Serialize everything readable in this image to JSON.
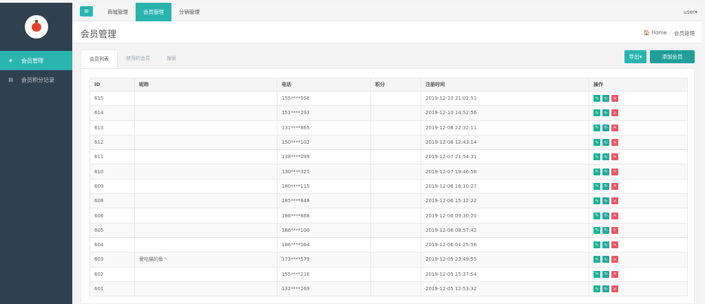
{
  "sidebar": {
    "items": [
      {
        "label": "会员管理",
        "icon": "shield-icon",
        "glyph": "◈",
        "active": true
      },
      {
        "label": "会员积分记录",
        "icon": "list-icon",
        "glyph": "▤",
        "active": false
      }
    ]
  },
  "topbar": {
    "menu_glyph": "≡",
    "nav": [
      {
        "label": "商城管理",
        "active": false
      },
      {
        "label": "会员管理",
        "active": true
      },
      {
        "label": "分销管理",
        "active": false
      }
    ],
    "user": "user▾"
  },
  "header": {
    "title": "会员管理",
    "breadcrumb": {
      "home": "🏠 Home",
      "sep": "/",
      "current": "会员管理"
    }
  },
  "tabs": [
    {
      "label": "会员列表",
      "active": true
    },
    {
      "label": "禁用的会员",
      "active": false
    },
    {
      "label": "搜索",
      "active": false
    }
  ],
  "actions": {
    "export_label": "导出▾",
    "add_label": "添加会员"
  },
  "table": {
    "columns": [
      "ID",
      "昵称",
      "电话",
      "积分",
      "注册时间",
      "操作"
    ],
    "rows": [
      [
        "615",
        "",
        "155****558",
        "",
        "2019-12-10 21:02:51"
      ],
      [
        "614",
        "",
        "151****293",
        "",
        "2019-12-10 14:52:56"
      ],
      [
        "613",
        "",
        "131****865",
        "",
        "2019-12-08 22:32:11"
      ],
      [
        "612",
        "",
        "150****102",
        "",
        "2019-12-08 12:43:14"
      ],
      [
        "611",
        "",
        "138****099",
        "",
        "2019-12-07 21:54:31"
      ],
      [
        "610",
        "",
        "130****321",
        "",
        "2019-12-07 19:46:56"
      ],
      [
        "609",
        "",
        "180****115",
        "",
        "2019-12-06 16:10:27"
      ],
      [
        "608",
        "",
        "185****848",
        "",
        "2019-12-06 15:12:22"
      ],
      [
        "606",
        "",
        "186****668",
        "",
        "2019-12-06 09:30:20"
      ],
      [
        "605",
        "",
        "186****100",
        "",
        "2019-12-06 08:57:42"
      ],
      [
        "604",
        "",
        "186****064",
        "",
        "2019-12-06 01:25:56"
      ],
      [
        "603",
        "爱吃猫的鱼丶",
        "173****579",
        "",
        "2019-12-05 23:49:55"
      ],
      [
        "602",
        "",
        "155****216",
        "",
        "2019-12-05 15:37:54"
      ],
      [
        "601",
        "",
        "132****269",
        "",
        "2019-12-05 12:53:32"
      ]
    ],
    "op_glyphs": {
      "edit": "✎",
      "sync": "↻",
      "delete": "✕"
    }
  }
}
